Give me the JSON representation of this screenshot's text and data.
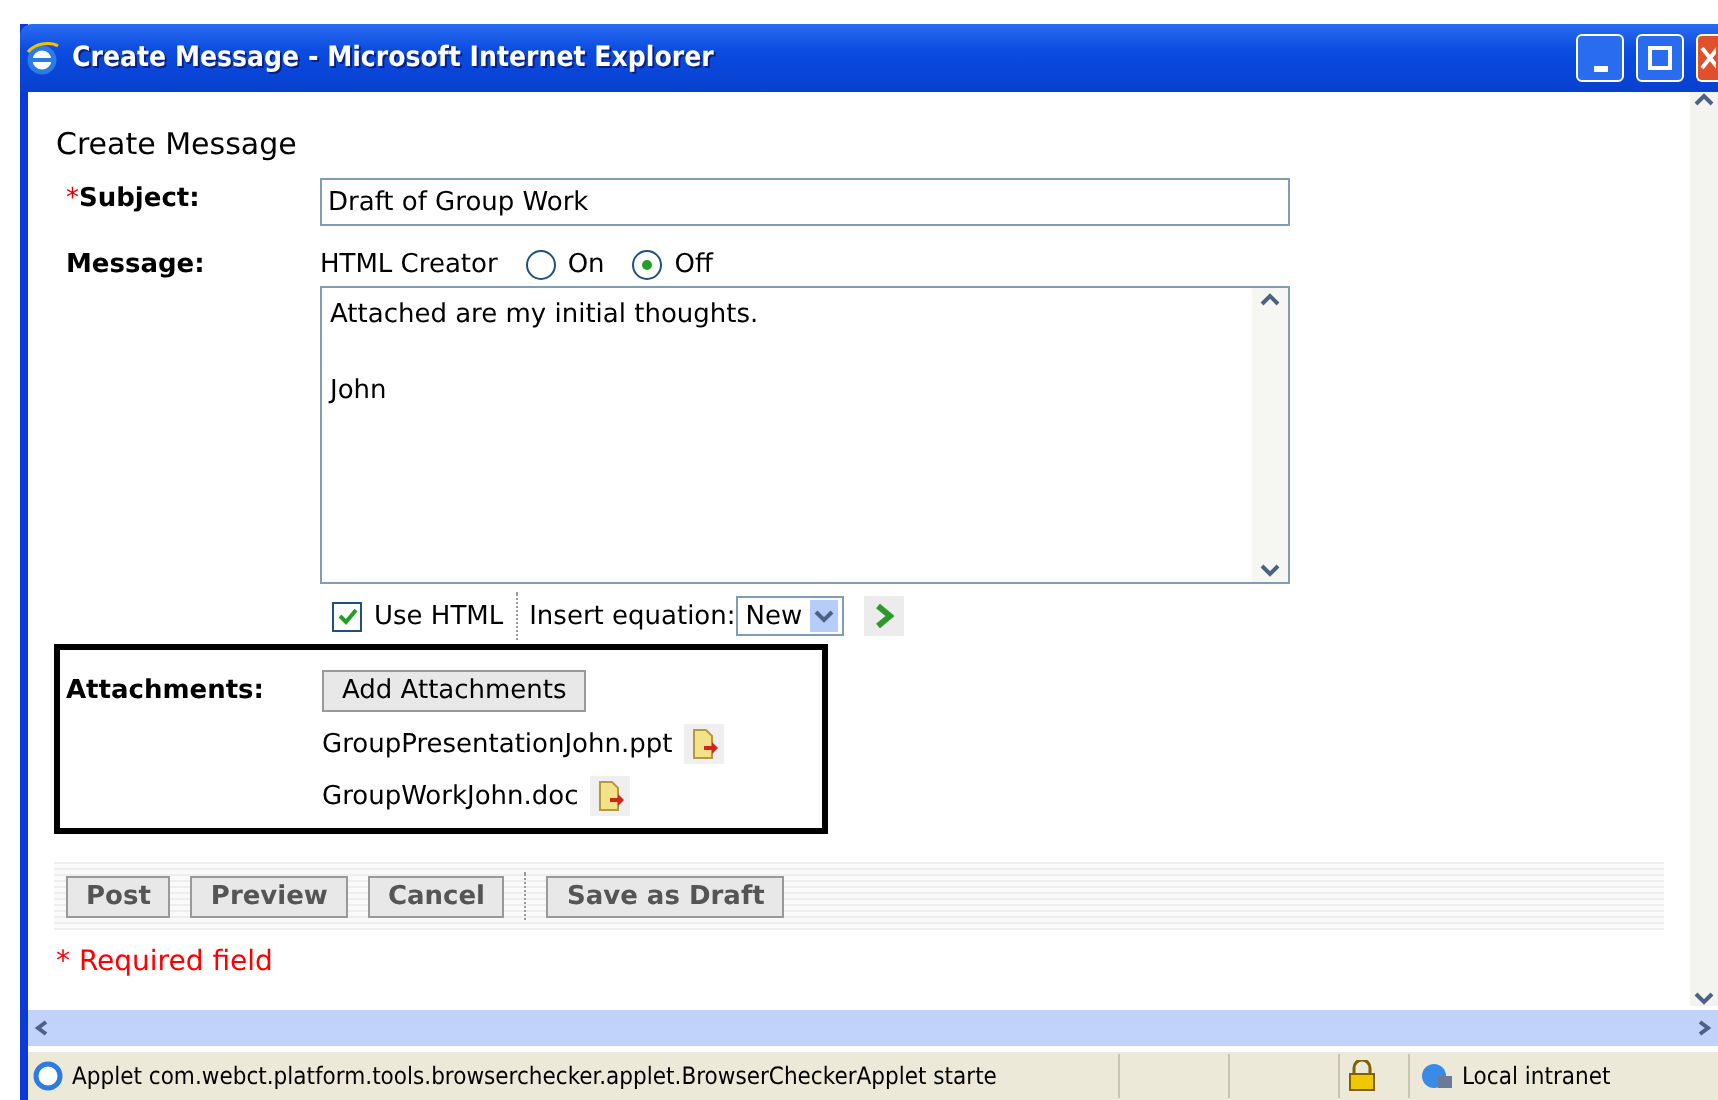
{
  "window": {
    "title": "Create Message - Microsoft Internet Explorer"
  },
  "page": {
    "heading": "Create Message"
  },
  "subject": {
    "required_mark": "*",
    "label": "Subject:",
    "value": "Draft of Group Work"
  },
  "message": {
    "label": "Message:",
    "html_creator": {
      "label": "HTML Creator",
      "options": [
        {
          "label": "On",
          "selected": false
        },
        {
          "label": "Off",
          "selected": true
        }
      ]
    },
    "value": "Attached are my initial thoughts.\n\nJohn"
  },
  "editor_options": {
    "use_html": {
      "label": "Use HTML",
      "checked": true
    },
    "equation_label": "Insert equation:",
    "equation_value": "New"
  },
  "attachments": {
    "label": "Attachments:",
    "add_button": "Add Attachments",
    "files": [
      "GroupPresentationJohn.ppt",
      "GroupWorkJohn.doc"
    ]
  },
  "action_groups": [
    [
      "Post",
      "Preview",
      "Cancel"
    ],
    [
      "Save as Draft"
    ]
  ],
  "required_note": "* Required field",
  "status_bar": {
    "text": "Applet com.webct.platform.tools.browserchecker.applet.BrowserCheckerApplet starte",
    "zone": "Local intranet"
  }
}
